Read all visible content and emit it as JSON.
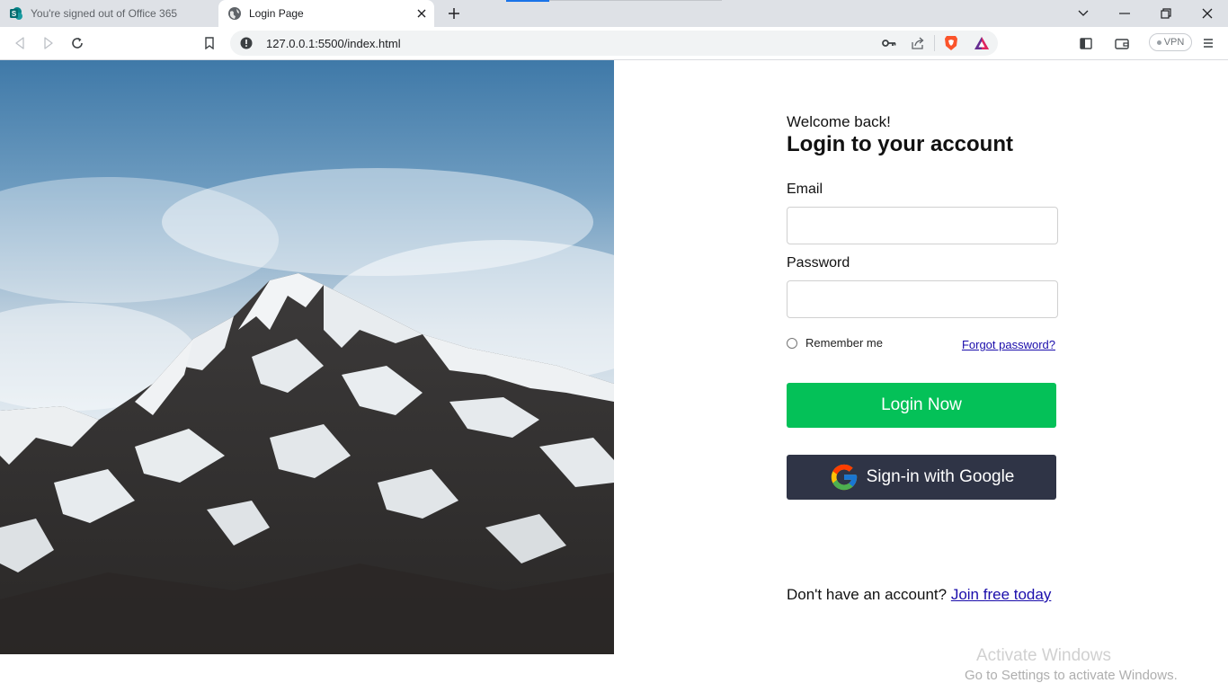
{
  "browser": {
    "tabs": [
      {
        "title": "You're signed out of Office 365",
        "icon": "sharepoint-icon",
        "active": false
      },
      {
        "title": "Login Page",
        "icon": "globe-icon",
        "active": true
      }
    ],
    "url": "127.0.0.1:5500/index.html",
    "vpn_label": "VPN"
  },
  "login": {
    "welcome": "Welcome back!",
    "heading": "Login to your account",
    "email_label": "Email",
    "password_label": "Password",
    "email_value": "",
    "password_value": "",
    "remember_label": "Remember me",
    "forgot_label": "Forgot password?",
    "login_button": "Login Now",
    "google_button": "Sign-in with Google",
    "signup_prompt": "Don't have an account?",
    "signup_link": "Join free today"
  },
  "watermark": {
    "line1": "Activate Windows",
    "line2": "Go to Settings to activate Windows."
  },
  "colors": {
    "login_button": "#04c158",
    "google_button": "#2f3446",
    "link": "#1a0dab"
  }
}
